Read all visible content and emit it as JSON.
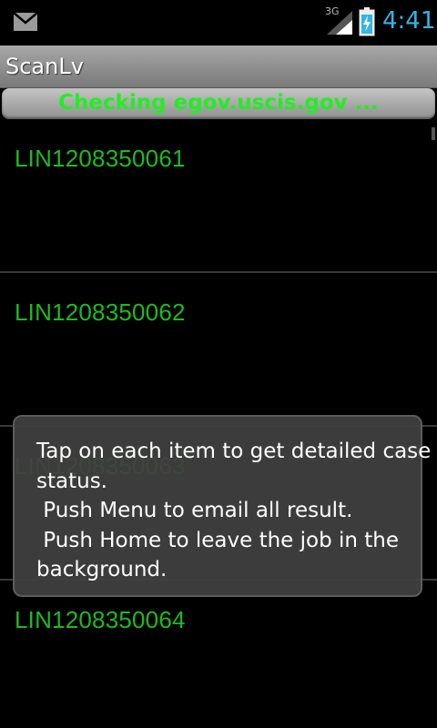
{
  "status_bar": {
    "network_type": "3G",
    "time": "4:41",
    "icons": [
      "mail-icon",
      "signal-icon",
      "battery-charging-icon"
    ]
  },
  "app": {
    "title": "ScanLv"
  },
  "status_strip": {
    "text": "Checking egov.uscis.gov ..."
  },
  "cases": [
    {
      "id": "LIN1208350061"
    },
    {
      "id": "LIN1208350062"
    },
    {
      "id": "LIN1208350063"
    },
    {
      "id": "LIN1208350064"
    }
  ],
  "toast": {
    "lines": [
      "Tap on each item to get detailed case",
      "status.",
      " Push Menu to email all result.",
      " Push Home to leave the job in the",
      "background."
    ]
  },
  "colors": {
    "background": "#000000",
    "case_id_green": "#1dbb1d",
    "status_green": "#22ee22",
    "clock_blue": "#33b5e5"
  }
}
